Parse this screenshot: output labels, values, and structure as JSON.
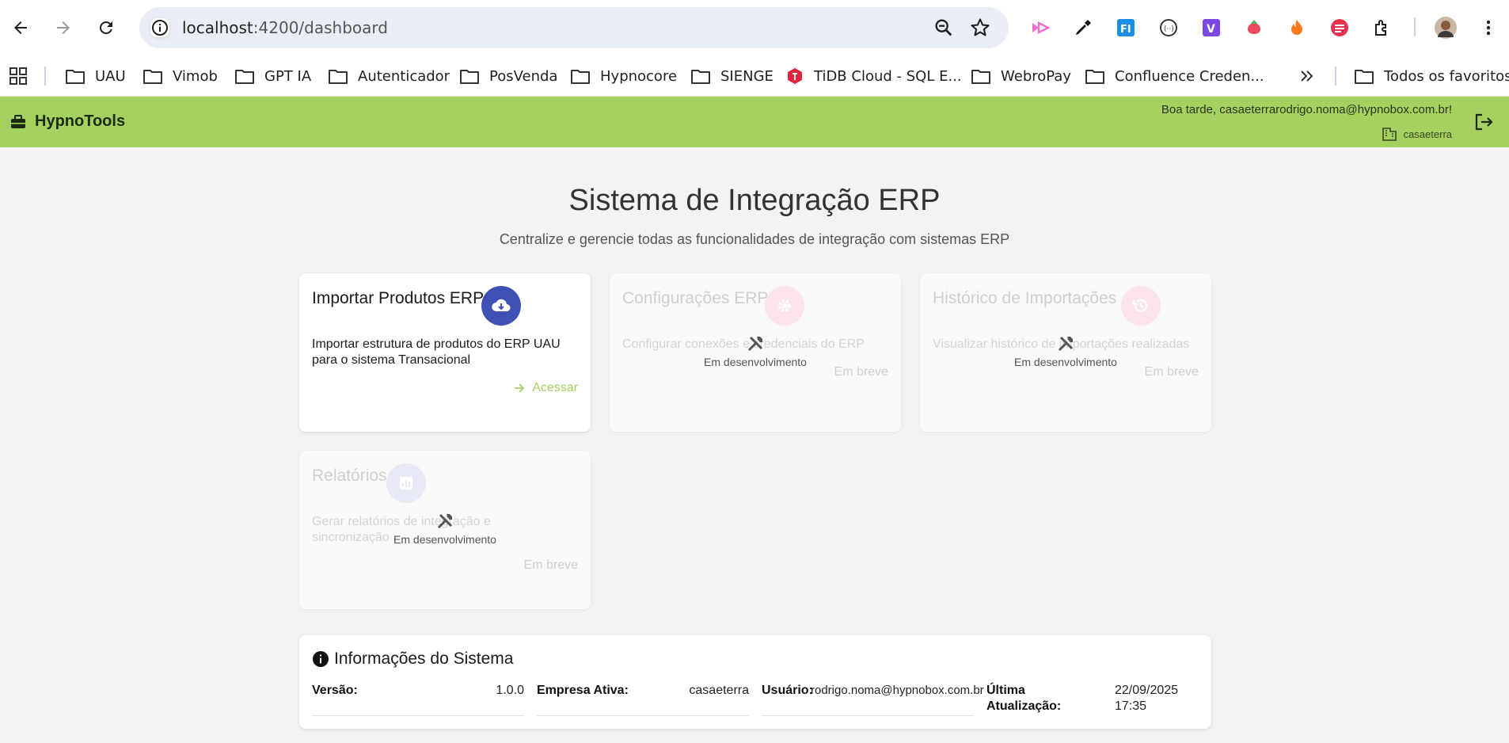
{
  "browser": {
    "url_host": "localhost",
    "url_path": ":4200/dashboard",
    "bookmarks": [
      {
        "label": "UAU"
      },
      {
        "label": "Vimob"
      },
      {
        "label": "GPT IA"
      },
      {
        "label": "Autenticador"
      },
      {
        "label": "PosVenda"
      },
      {
        "label": "Hypnocore"
      },
      {
        "label": "SIENGE"
      },
      {
        "label": "TiDB Cloud - SQL E..."
      },
      {
        "label": "WebroPay"
      },
      {
        "label": "Confluence Creden..."
      }
    ],
    "all_bookmarks_label": "Todos os favoritos"
  },
  "app": {
    "brand": "HypnoTools",
    "greeting": "Boa tarde, casaeterrarodrigo.noma@hypnobox.com.br!",
    "company": "casaeterra",
    "accent_color": "#a5d160"
  },
  "hero": {
    "title": "Sistema de Integração ERP",
    "subtitle": "Centralize e gerencie todas as funcionalidades de integração com sistemas ERP"
  },
  "cards": [
    {
      "title": "Importar Produtos ERP",
      "description": "Importar estrutura de produtos do ERP UAU para o sistema Transacional",
      "action": "Acessar",
      "icon": "cloud-download-icon",
      "icon_color": "#3f51b5"
    },
    {
      "title": "Configurações ERP",
      "description": "Configurar conexões e credenciais do ERP",
      "status": "Em desenvolvimento",
      "badge": "Em breve",
      "icon": "gear-icon"
    },
    {
      "title": "Histórico de Importações",
      "description": "Visualizar histórico de importações realizadas",
      "status": "Em desenvolvimento",
      "badge": "Em breve",
      "icon": "history-icon"
    },
    {
      "title": "Relatórios",
      "description": "Gerar relatórios de integração e sincronização",
      "status": "Em desenvolvimento",
      "badge": "Em breve",
      "icon": "bar-chart-icon"
    }
  ],
  "system_info": {
    "title": "Informações do Sistema",
    "version_label": "Versão:",
    "version": "1.0.0",
    "company_label": "Empresa Ativa:",
    "company": "casaeterra",
    "user_label": "Usuário:",
    "user": "rodrigo.noma@hypnobox.com.br",
    "updated_label": "Última Atualização:",
    "updated": "22/09/2025 17:35"
  }
}
